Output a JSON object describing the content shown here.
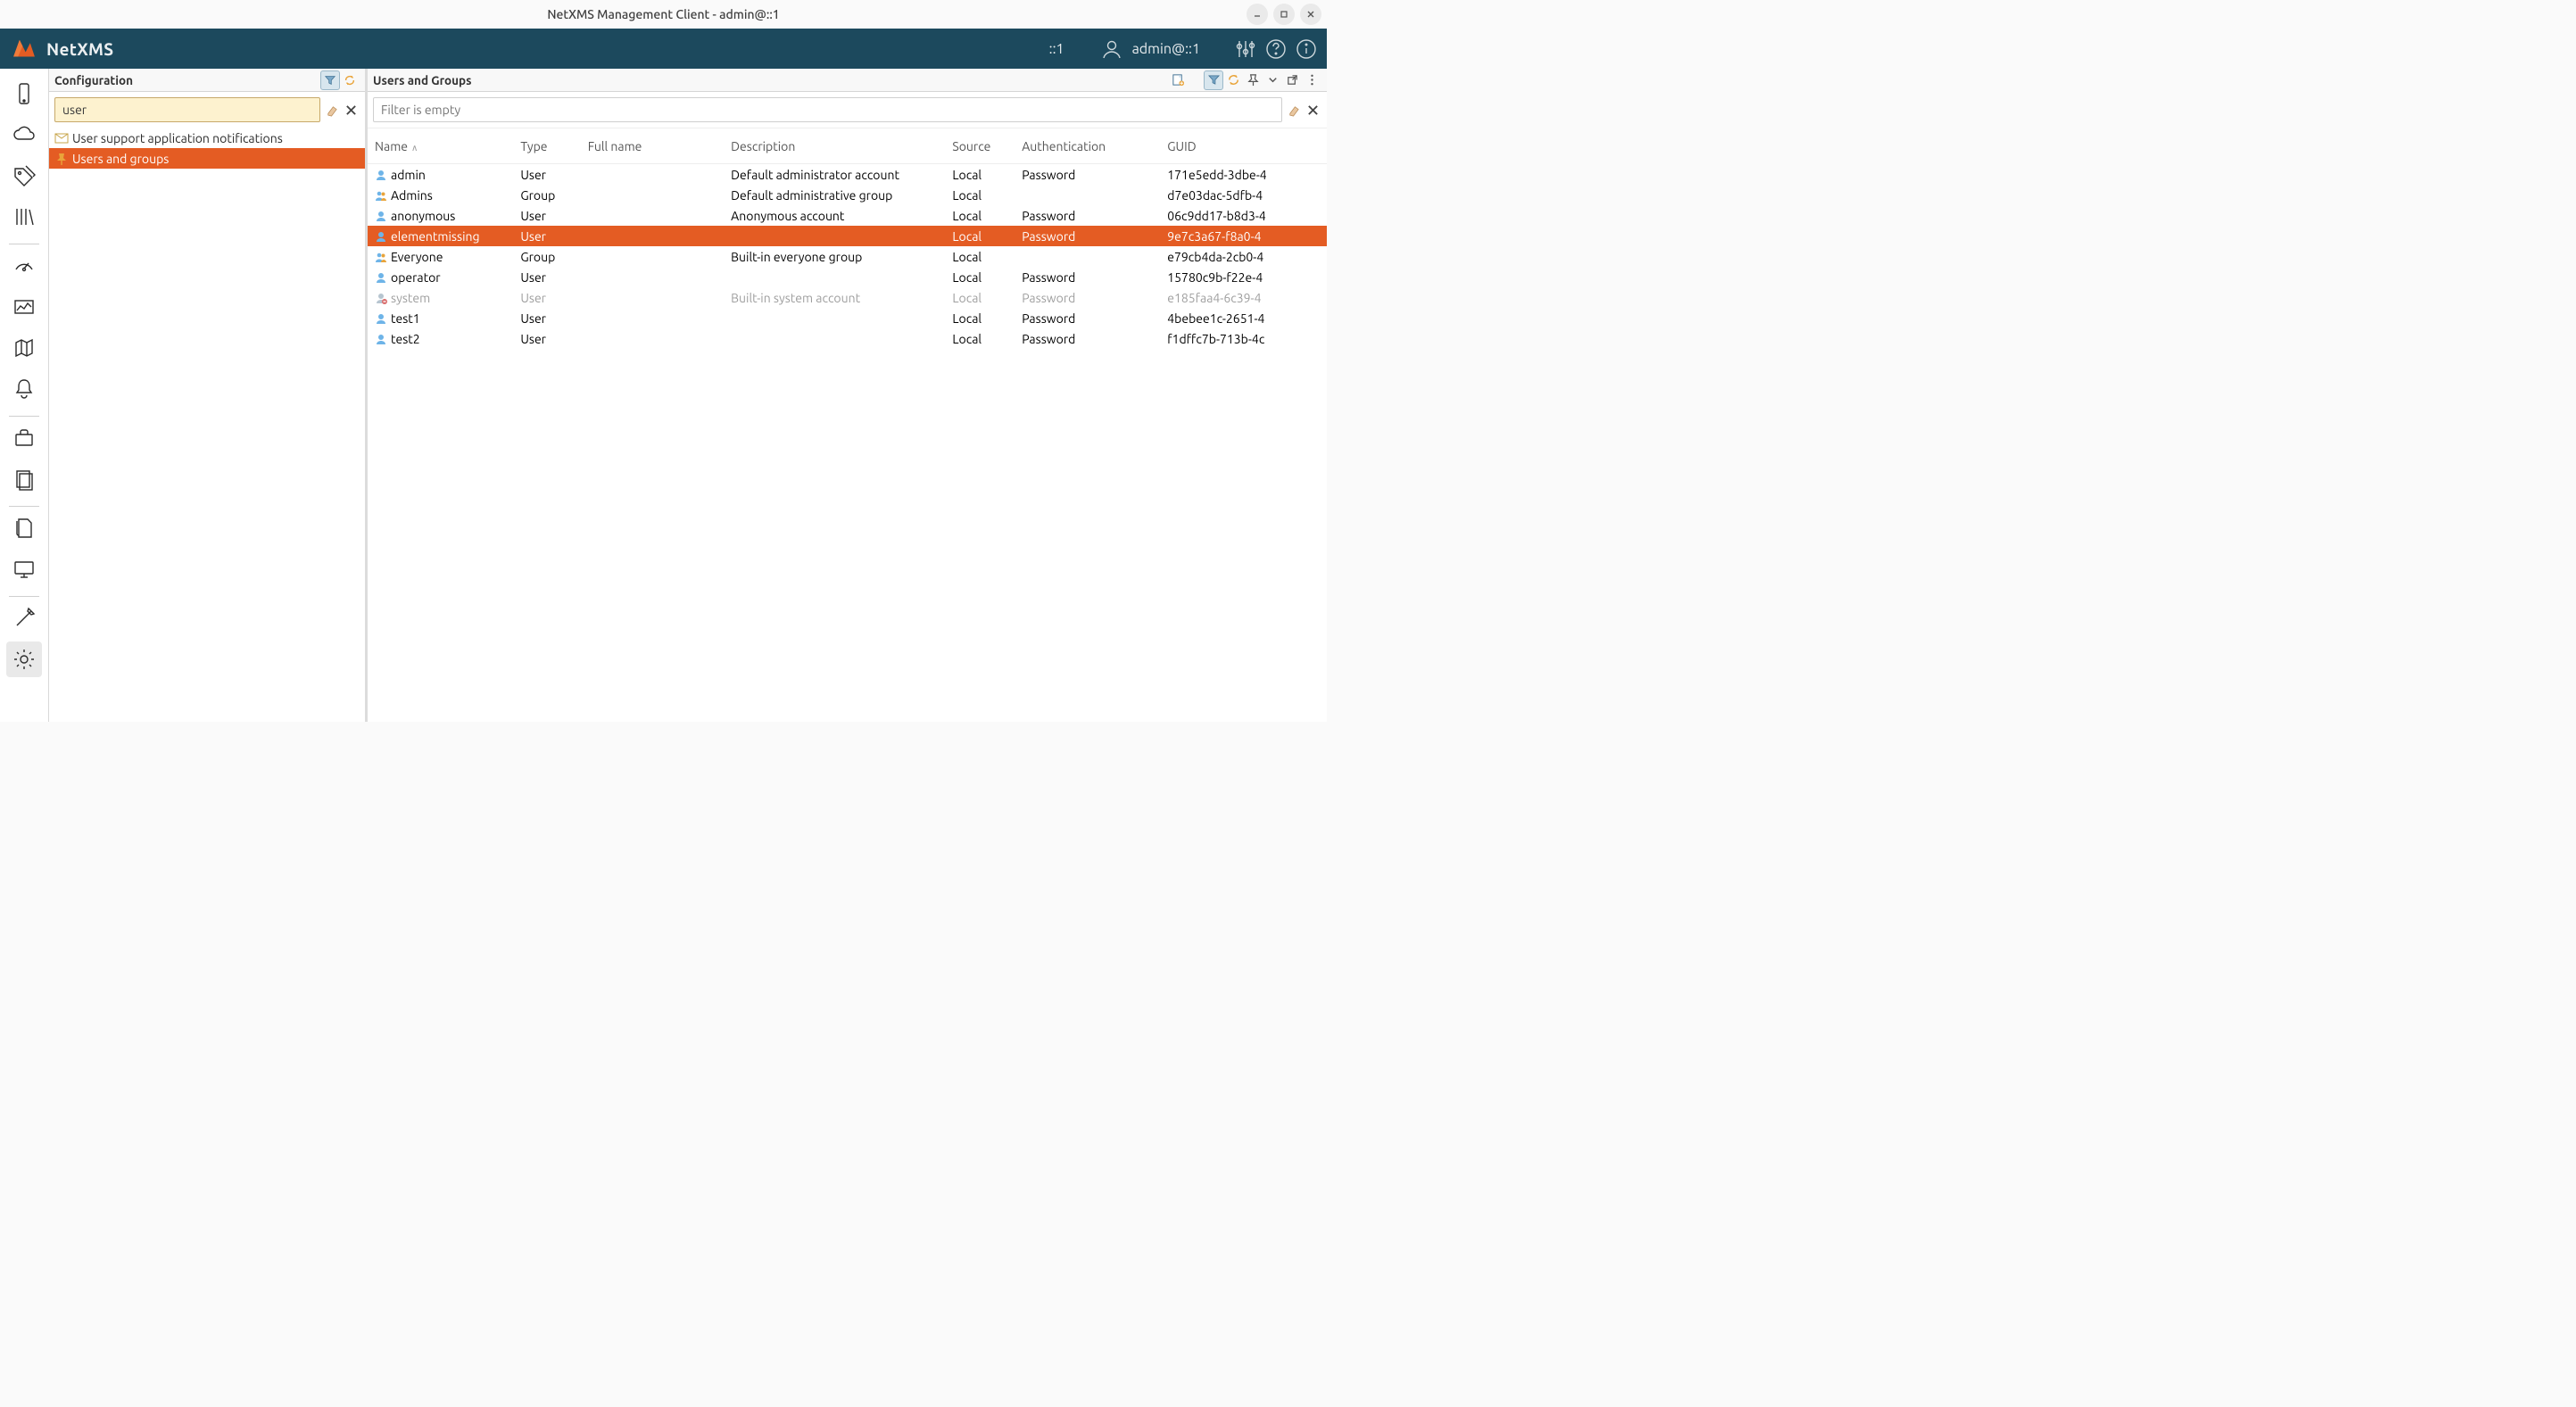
{
  "window": {
    "title": "NetXMS Management Client - admin@::1"
  },
  "appbar": {
    "brand": "NetXMS",
    "session": "::1",
    "user": "admin@::1"
  },
  "config": {
    "title": "Configuration",
    "filter_value": "user",
    "items": [
      {
        "label": "User support application notifications",
        "selected": false,
        "icon": "mail"
      },
      {
        "label": "Users and groups",
        "selected": true,
        "icon": "pin"
      }
    ]
  },
  "main": {
    "title": "Users and Groups",
    "filter_placeholder": "Filter is empty",
    "filter_value": "",
    "columns": [
      "Name",
      "Type",
      "Full name",
      "Description",
      "Source",
      "Authentication",
      "GUID"
    ],
    "sort_column": "Name",
    "sort_dir": "asc",
    "rows": [
      {
        "name": "admin",
        "type": "User",
        "fullname": "",
        "desc": "Default administrator account",
        "source": "Local",
        "auth": "Password",
        "guid": "171e5edd-3dbe-4",
        "icon": "user",
        "selected": false,
        "disabled": false
      },
      {
        "name": "Admins",
        "type": "Group",
        "fullname": "",
        "desc": "Default administrative group",
        "source": "Local",
        "auth": "",
        "guid": "d7e03dac-5dfb-4",
        "icon": "group",
        "selected": false,
        "disabled": false
      },
      {
        "name": "anonymous",
        "type": "User",
        "fullname": "",
        "desc": "Anonymous account",
        "source": "Local",
        "auth": "Password",
        "guid": "06c9dd17-b8d3-4",
        "icon": "user",
        "selected": false,
        "disabled": false
      },
      {
        "name": "elementmissing",
        "type": "User",
        "fullname": "",
        "desc": "",
        "source": "Local",
        "auth": "Password",
        "guid": "9e7c3a67-f8a0-4",
        "icon": "user",
        "selected": true,
        "disabled": false
      },
      {
        "name": "Everyone",
        "type": "Group",
        "fullname": "",
        "desc": "Built-in everyone group",
        "source": "Local",
        "auth": "",
        "guid": "e79cb4da-2cb0-4",
        "icon": "group",
        "selected": false,
        "disabled": false
      },
      {
        "name": "operator",
        "type": "User",
        "fullname": "",
        "desc": "",
        "source": "Local",
        "auth": "Password",
        "guid": "15780c9b-f22e-4",
        "icon": "user",
        "selected": false,
        "disabled": false
      },
      {
        "name": "system",
        "type": "User",
        "fullname": "",
        "desc": "Built-in system account",
        "source": "Local",
        "auth": "Password",
        "guid": "e185faa4-6c39-4",
        "icon": "user-x",
        "selected": false,
        "disabled": true
      },
      {
        "name": "test1",
        "type": "User",
        "fullname": "",
        "desc": "",
        "source": "Local",
        "auth": "Password",
        "guid": "4bebee1c-2651-4",
        "icon": "user",
        "selected": false,
        "disabled": false
      },
      {
        "name": "test2",
        "type": "User",
        "fullname": "",
        "desc": "",
        "source": "Local",
        "auth": "Password",
        "guid": "f1dffc7b-713b-4c",
        "icon": "user",
        "selected": false,
        "disabled": false
      }
    ]
  }
}
